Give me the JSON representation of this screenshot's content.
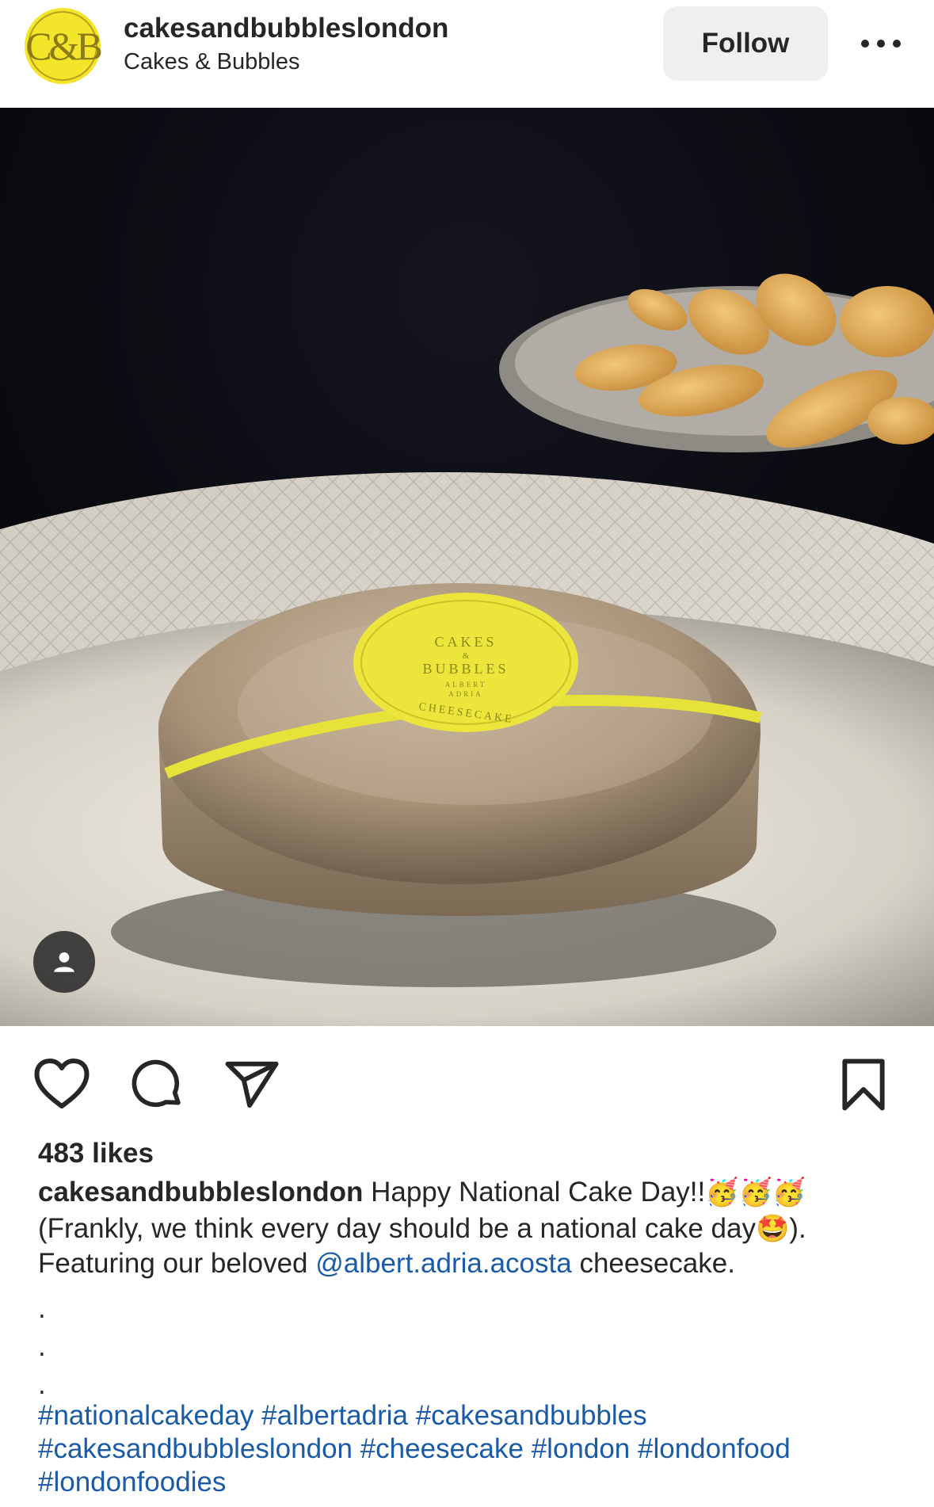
{
  "header": {
    "avatar_monogram": "&B",
    "username": "cakesandbubbleslondon",
    "display_name": "Cakes & Bubbles",
    "follow_label": "Follow",
    "more_icon": "more-horizontal-icon"
  },
  "photo": {
    "label_lines": [
      "CAKES",
      "&",
      "BUBBLES",
      "ALBERT",
      "ADRIA",
      "CHEESECAKE"
    ],
    "tag_icon": "user-tag-icon"
  },
  "actions": {
    "like_icon": "heart-icon",
    "comment_icon": "comment-icon",
    "share_icon": "paper-plane-icon",
    "save_icon": "bookmark-icon"
  },
  "likes": "483 likes",
  "caption": {
    "username": "cakesandbubbleslondon",
    "line1_text": "Happy National Cake Day!!",
    "line1_emojis": "🥳🥳🥳",
    "line2_before": "(Frankly, we think every day should be a national cake day",
    "line2_emoji": "🤩",
    "line2_after": ").",
    "line3_before": "Featuring our beloved ",
    "mention": "@albert.adria.acosta",
    "line3_after": " cheesecake.",
    "dot": "."
  },
  "hashtags": {
    "line1": "#nationalcakeday #albertadria #cakesandbubbles",
    "line2": "#cakesandbubbleslondon #cheesecake #london #londonfood",
    "line3": "#londonfoodies"
  },
  "colors": {
    "link": "#1a5aa6",
    "text": "#262626",
    "follow_bg": "#efefef",
    "brand_yellow": "#f3e529"
  }
}
